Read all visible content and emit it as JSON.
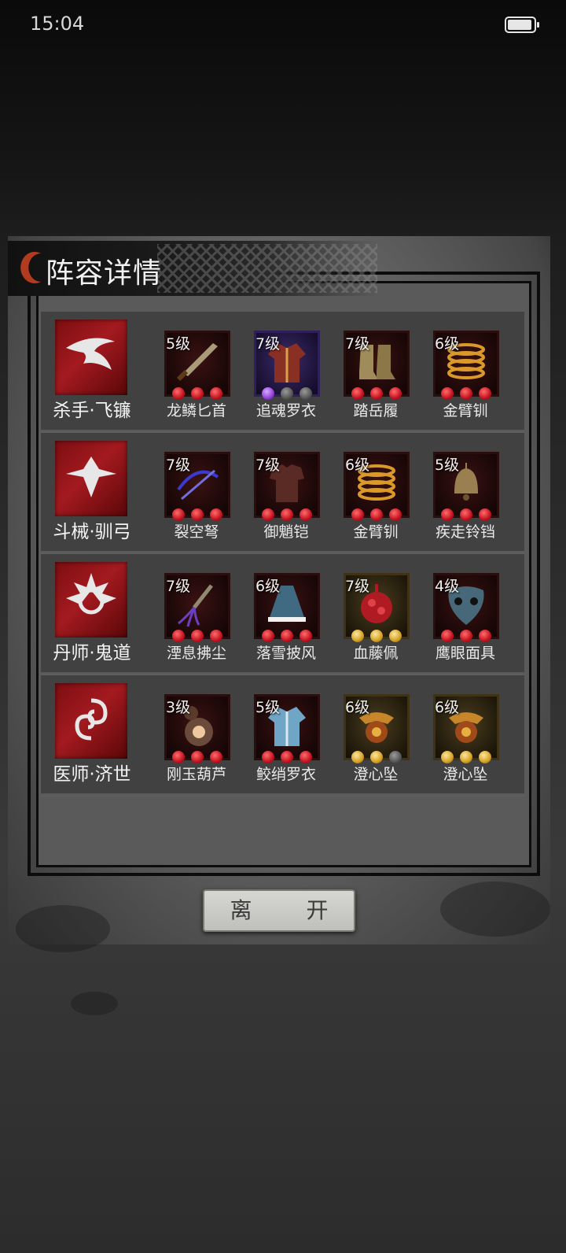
{
  "status_bar": {
    "time": "15:04"
  },
  "dialog": {
    "title": "阵容详情",
    "leave_button": "离 开"
  },
  "lineup": [
    {
      "hero": "杀手·飞镰",
      "items": [
        {
          "level": "5级",
          "name": "龙鳞匕首",
          "quality": "red",
          "gems": [
            "red",
            "red",
            "red"
          ]
        },
        {
          "level": "7级",
          "name": "追魂罗衣",
          "quality": "purple",
          "gems": [
            "purple",
            "grey",
            "grey"
          ]
        },
        {
          "level": "7级",
          "name": "踏岳履",
          "quality": "red",
          "gems": [
            "red",
            "red",
            "red"
          ]
        },
        {
          "level": "6级",
          "name": "金臂钏",
          "quality": "red",
          "gems": [
            "red",
            "red",
            "red"
          ]
        }
      ]
    },
    {
      "hero": "斗械·驯弓",
      "items": [
        {
          "level": "7级",
          "name": "裂空弩",
          "quality": "red",
          "gems": [
            "red",
            "red",
            "red"
          ]
        },
        {
          "level": "7级",
          "name": "御魈铠",
          "quality": "red",
          "gems": [
            "red",
            "red",
            "red"
          ]
        },
        {
          "level": "6级",
          "name": "金臂钏",
          "quality": "red",
          "gems": [
            "red",
            "red",
            "red"
          ]
        },
        {
          "level": "5级",
          "name": "疾走铃铛",
          "quality": "red",
          "gems": [
            "red",
            "red",
            "red"
          ]
        }
      ]
    },
    {
      "hero": "丹师·鬼道",
      "items": [
        {
          "level": "7级",
          "name": "湮息拂尘",
          "quality": "red",
          "gems": [
            "red",
            "red",
            "red"
          ]
        },
        {
          "level": "6级",
          "name": "落雪披风",
          "quality": "red",
          "gems": [
            "red",
            "red",
            "red"
          ]
        },
        {
          "level": "7级",
          "name": "血藤佩",
          "quality": "gold",
          "gems": [
            "gold",
            "gold",
            "gold"
          ]
        },
        {
          "level": "4级",
          "name": "鹰眼面具",
          "quality": "red",
          "gems": [
            "red",
            "red",
            "red"
          ]
        }
      ]
    },
    {
      "hero": "医师·济世",
      "items": [
        {
          "level": "3级",
          "name": "刚玉葫芦",
          "quality": "red",
          "gems": [
            "red",
            "red",
            "red"
          ]
        },
        {
          "level": "5级",
          "name": "鲛绡罗衣",
          "quality": "red",
          "gems": [
            "red",
            "red",
            "red"
          ]
        },
        {
          "level": "6级",
          "name": "澄心坠",
          "quality": "gold",
          "gems": [
            "gold",
            "gold",
            "grey"
          ]
        },
        {
          "level": "6级",
          "name": "澄心坠",
          "quality": "gold",
          "gems": [
            "gold",
            "gold",
            "gold"
          ]
        }
      ]
    }
  ]
}
